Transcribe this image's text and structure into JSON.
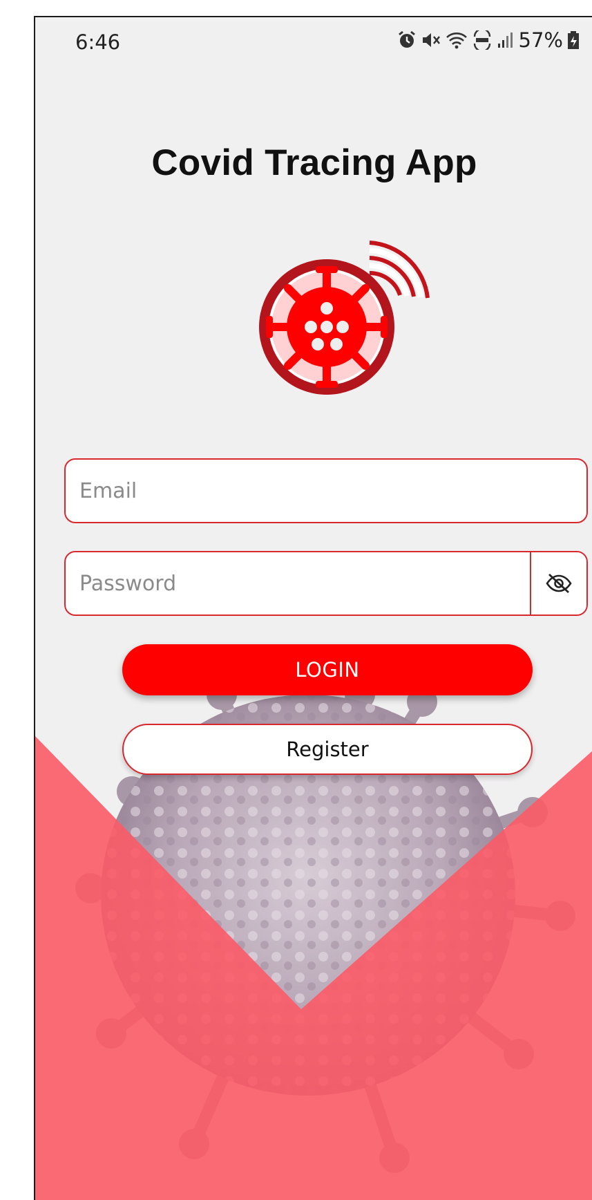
{
  "status_bar": {
    "time": "6:46",
    "battery_percent": "57%",
    "icons": [
      "alarm-icon",
      "mute-icon",
      "wifi-icon",
      "volte-icon",
      "signal-icon",
      "battery-icon"
    ]
  },
  "app": {
    "title": "Covid Tracing App",
    "logo": "virus-broadcast-logo"
  },
  "form": {
    "email_placeholder": "Email",
    "email_value": "",
    "password_placeholder": "Password",
    "password_value": "",
    "password_toggle_icon": "eye-off-icon"
  },
  "buttons": {
    "login_label": "LOGIN",
    "register_label": "Register"
  },
  "colors": {
    "accent": "#fe0000",
    "border": "#d9272e",
    "background": "#f1f0f1",
    "background_overlay": "#fb5b67"
  }
}
